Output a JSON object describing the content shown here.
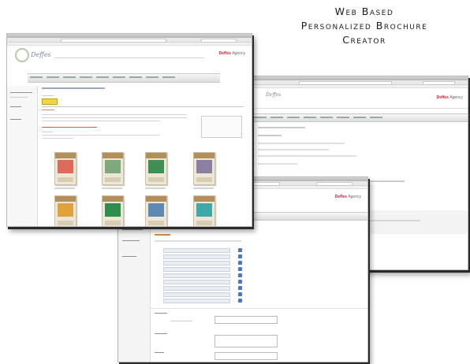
{
  "heading": {
    "line1": "Web Based",
    "line2": "Personalized Brochure",
    "line3": "Creator"
  },
  "window_main": {
    "brand": "Deffes",
    "brand_suffix": "Agency",
    "thumbnails": [
      {
        "color": "#e06a5a"
      },
      {
        "color": "#7fa87d"
      },
      {
        "color": "#3f8f55"
      },
      {
        "color": "#8b7fa3"
      },
      {
        "color": "#e0a23a"
      },
      {
        "color": "#2e8e4e"
      },
      {
        "color": "#5d89b3"
      },
      {
        "color": "#3fa9a7"
      }
    ]
  },
  "window_right": {
    "brand": "Deffes",
    "brand_suffix": "Agency"
  },
  "window_mid": {
    "brand": "Deffes",
    "brand_suffix": "Agency"
  },
  "colors": {
    "accent": "#c2272d",
    "highlight": "#f2d641",
    "checkbox": "#4a76c5"
  }
}
